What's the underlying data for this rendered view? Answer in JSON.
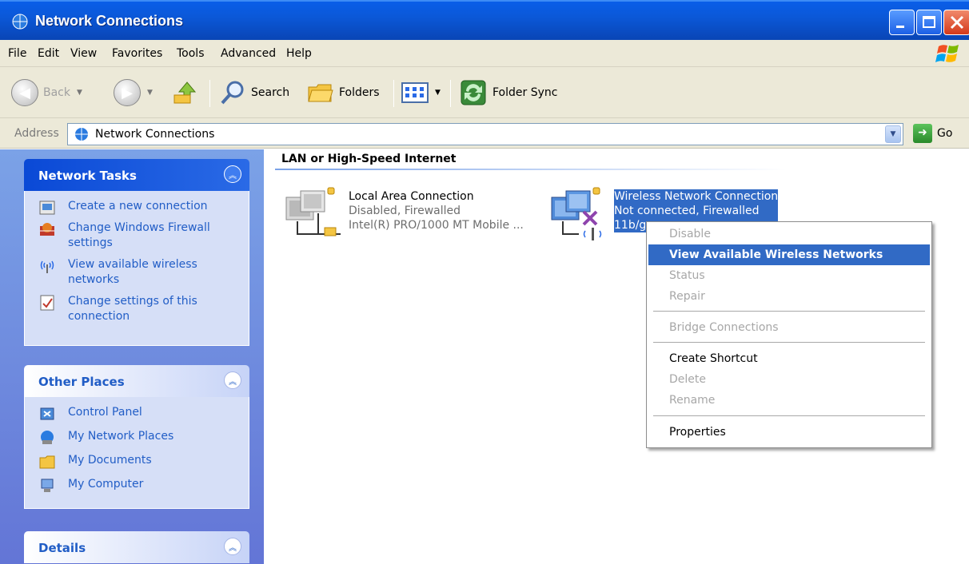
{
  "window": {
    "title": "Network Connections"
  },
  "menubar": [
    "File",
    "Edit",
    "View",
    "Favorites",
    "Tools",
    "Advanced",
    "Help"
  ],
  "toolbar": {
    "back": "Back",
    "search": "Search",
    "folders": "Folders",
    "folder_sync": "Folder Sync"
  },
  "address": {
    "label": "Address",
    "value": "Network Connections",
    "go": "Go"
  },
  "tasks": {
    "network": {
      "title": "Network Tasks",
      "items": [
        "Create a new connection",
        "Change Windows Firewall settings",
        "View available wireless networks",
        "Change settings of this connection"
      ]
    },
    "other": {
      "title": "Other Places",
      "items": [
        "Control Panel",
        "My Network Places",
        "My Documents",
        "My Computer"
      ]
    },
    "details": {
      "title": "Details"
    }
  },
  "content": {
    "group_title": "LAN or High-Speed Internet",
    "connections": [
      {
        "name": "Local Area Connection",
        "status": "Disabled, Firewalled",
        "device": "Intel(R) PRO/1000 MT Mobile ..."
      },
      {
        "name": "Wireless Network Connection",
        "status": "Not connected, Firewalled",
        "device": "11b/g"
      }
    ]
  },
  "context_menu": {
    "items": [
      {
        "label": "Disable",
        "state": "disabled"
      },
      {
        "label": "View Available Wireless Networks",
        "state": "highlighted"
      },
      {
        "label": "Status",
        "state": "disabled"
      },
      {
        "label": "Repair",
        "state": "disabled"
      },
      {
        "label": "Bridge Connections",
        "state": "disabled"
      },
      {
        "label": "Create Shortcut",
        "state": "enabled"
      },
      {
        "label": "Delete",
        "state": "disabled"
      },
      {
        "label": "Rename",
        "state": "disabled"
      },
      {
        "label": "Properties",
        "state": "enabled"
      }
    ]
  },
  "colors": {
    "title_bar": "#0b58d8",
    "selection": "#316ac5",
    "task_pane": "#7ba2e7",
    "link": "#215dc6"
  }
}
